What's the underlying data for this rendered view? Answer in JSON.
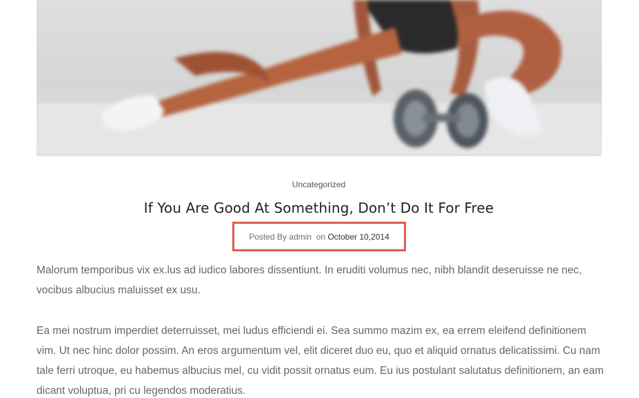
{
  "post": {
    "category": "Uncategorized",
    "title": "If You Are Good At Something, Don’t Do It For Free",
    "meta": {
      "posted_by_label": "Posted By",
      "author": "admin",
      "on_label": "on",
      "date": "October 10,2014"
    },
    "paragraphs": [
      "Malorum temporibus vix ex.lus ad iudico labores dissentiunt. In eruditi volumus nec, nibh blandit deseruisse ne nec, vocibus albucius maluisset ex usu.",
      "Ea mei nostrum imperdiet deterruisset, mei ludus efficiendi ei. Sea summo mazim ex, ea errem eleifend definitionem vim. Ut nec hinc dolor possim. An eros argumentum vel, elit diceret duo eu, quo et aliquid ornatus delicatissimi. Cu nam tale ferri utroque, eu habemus albucius mel, cu vidit possit ornatus eum. Eu ius postulant salutatus definitionem, an eam dicant voluptua, pri cu legendos moderatius."
    ]
  },
  "colors": {
    "highlight_border": "#e05a50",
    "body_text": "#666666",
    "title_text": "#222222"
  }
}
